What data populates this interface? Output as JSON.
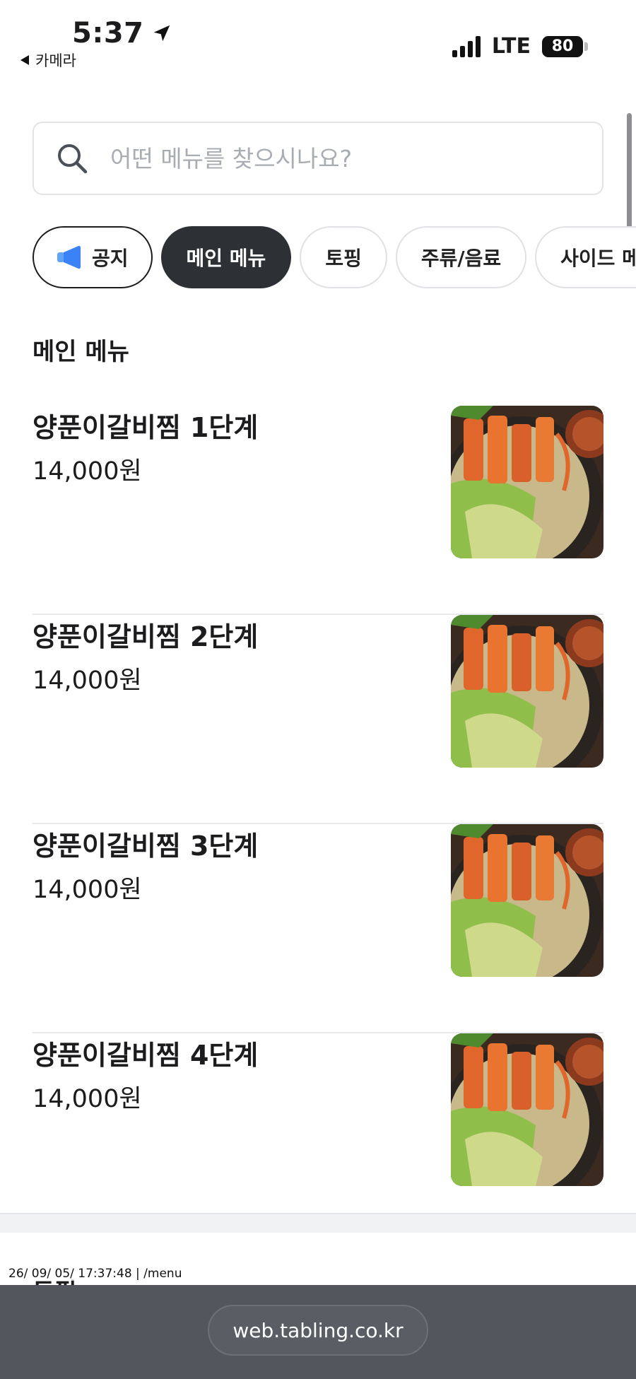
{
  "status_bar": {
    "time": "5:37",
    "back_label": "카메라",
    "network": "LTE",
    "battery": "80"
  },
  "search": {
    "placeholder": "어떤 메뉴를 찾으시나요?"
  },
  "categories": [
    {
      "label": "공지",
      "active": false
    },
    {
      "label": "메인 메뉴",
      "active": true
    },
    {
      "label": "토핑",
      "active": false
    },
    {
      "label": "주류/음료",
      "active": false
    },
    {
      "label": "사이드 메뉴",
      "active": false
    }
  ],
  "section": {
    "title": "메인 메뉴",
    "items": [
      {
        "name": "양푼이갈비찜 1단계",
        "price": "14,000원"
      },
      {
        "name": "양푼이갈비찜 2단계",
        "price": "14,000원"
      },
      {
        "name": "양푼이갈비찜 3단계",
        "price": "14,000원"
      },
      {
        "name": "양푼이갈비찜 4단계",
        "price": "14,000원"
      }
    ]
  },
  "next_section": {
    "title": "토핑"
  },
  "overlay": {
    "timestamp": "26/ 09/ 05/ 17:37:48 | /menu"
  },
  "browser": {
    "url": "web.tabling.co.kr"
  },
  "colors": {
    "active_chip": "#2d3035",
    "accent_blue": "#3b82f6",
    "bottom_bar": "#53565d"
  },
  "icons": [
    "location-arrow-icon",
    "back-triangle-icon",
    "signal-icon",
    "battery-icon",
    "search-icon",
    "megaphone-icon"
  ]
}
